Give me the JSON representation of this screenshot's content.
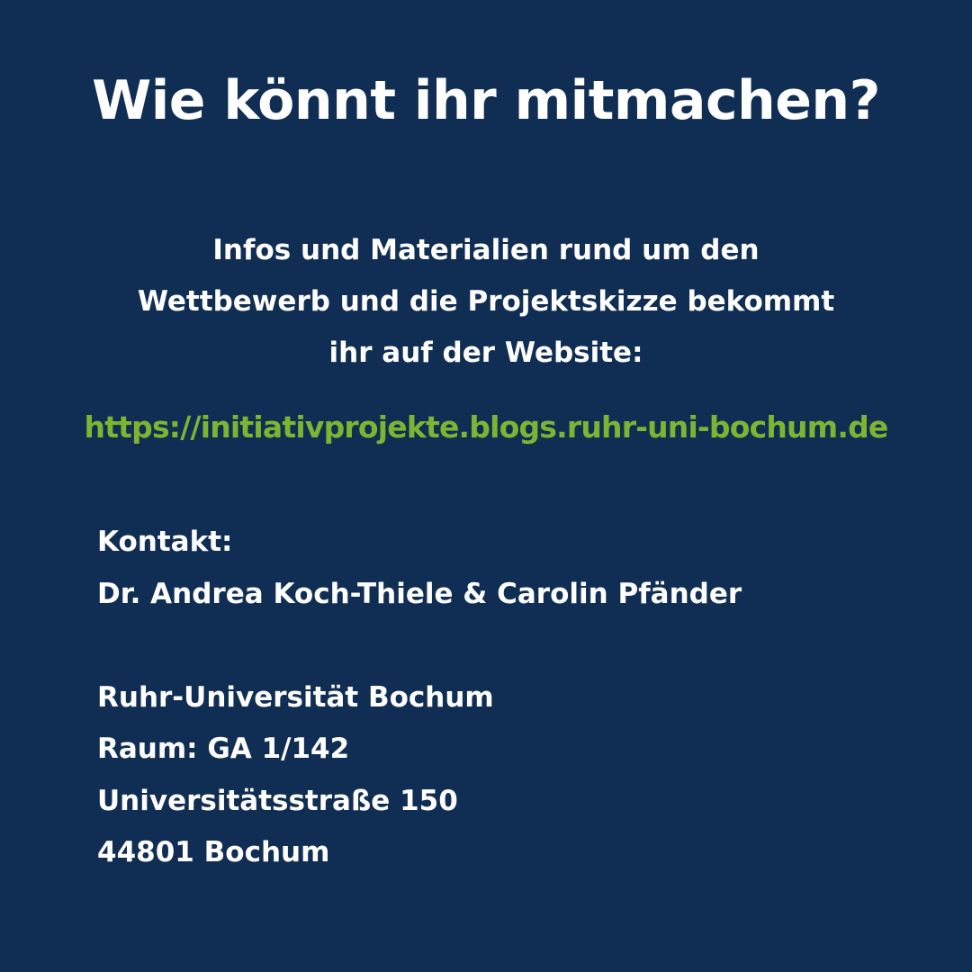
{
  "headline": "Wie könnt ihr mitmachen?",
  "intro": {
    "lines": [
      "Infos und Materialien rund um den",
      "Wettbewerb und die Projektskizze bekommt",
      "ihr auf der Website:"
    ]
  },
  "website": {
    "url": "https://initiativprojekte.blogs.ruhr-uni-bochum.de",
    "color": "#7cb531"
  },
  "contact": {
    "label": "Kontakt:",
    "names": "Dr. Andrea Koch-Thiele & Carolin Pfänder",
    "address": [
      "Ruhr-Universität Bochum",
      "Raum: GA 1/142",
      "Universitätsstraße 150",
      "44801 Bochum"
    ]
  },
  "colors": {
    "background": "#102e54",
    "text": "#ffffff"
  }
}
